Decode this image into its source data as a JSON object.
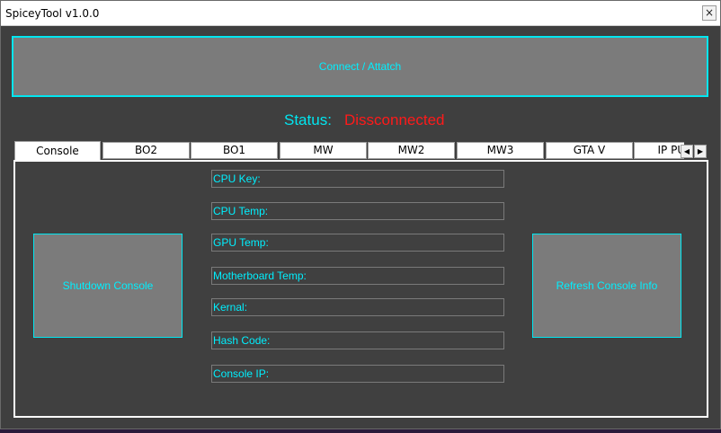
{
  "window": {
    "title": "SpiceyTool v1.0.0",
    "close_label": "×"
  },
  "connect_button": {
    "label": "Connect / Attatch"
  },
  "status": {
    "label": "Status:",
    "value": "Dissconnected",
    "value_color": "#ff1a1a"
  },
  "tabs": [
    {
      "label": "Console",
      "active": true
    },
    {
      "label": "BO2"
    },
    {
      "label": "BO1"
    },
    {
      "label": "MW"
    },
    {
      "label": "MW2"
    },
    {
      "label": "MW3"
    },
    {
      "label": "GTA V"
    },
    {
      "label": "IP PULL"
    }
  ],
  "tab_scroll": {
    "left": "◀",
    "right": "▶"
  },
  "console_panel": {
    "shutdown_label": "Shutdown Console",
    "refresh_label": "Refresh Console Info",
    "fields": [
      "CPU Key:",
      "CPU Temp:",
      "GPU Temp:",
      "Motherboard Temp:",
      "Kernal:",
      "Hash Code:",
      "Console IP:"
    ]
  },
  "colors": {
    "accent": "#00f0ff",
    "button_bg": "#7b7b7b",
    "panel_bg": "#404040"
  }
}
